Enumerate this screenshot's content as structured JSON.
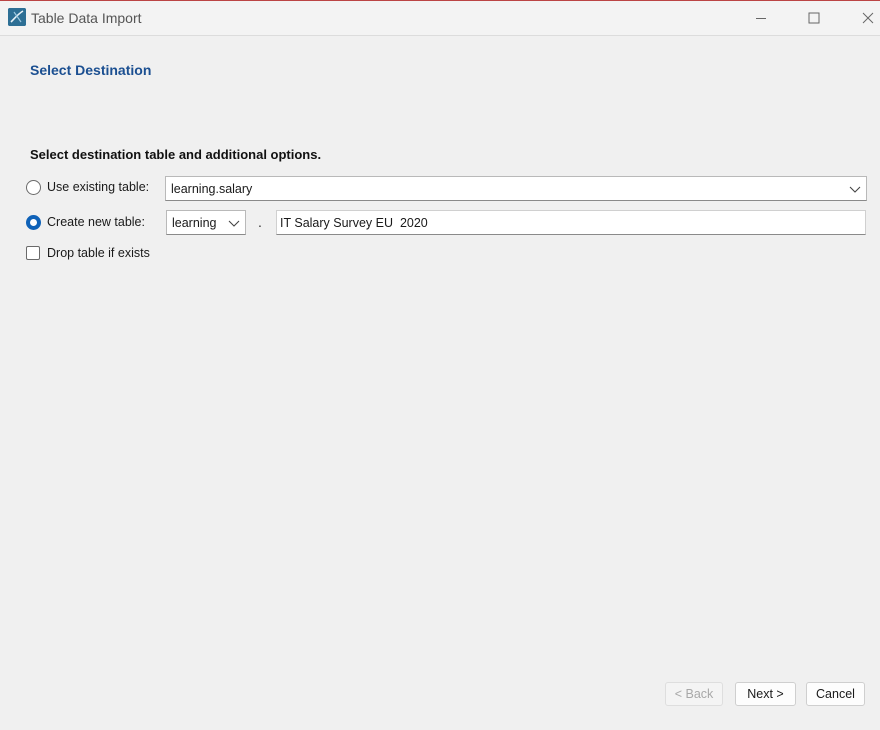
{
  "window": {
    "title": "Table Data Import"
  },
  "page": {
    "title": "Select Destination",
    "section_heading": "Select destination table and additional options."
  },
  "options": {
    "use_existing": {
      "label": "Use existing table:",
      "selected": false,
      "value": "learning.salary"
    },
    "create_new": {
      "label": "Create new table:",
      "selected": true,
      "schema_value": "learning",
      "separator": ".",
      "table_name": "IT Salary Survey EU  2020"
    },
    "drop_if_exists": {
      "label": "Drop table if exists",
      "checked": false
    }
  },
  "footer": {
    "back_label": "< Back",
    "next_label": "Next >",
    "cancel_label": "Cancel"
  },
  "colors": {
    "heading_blue": "#1b4f91",
    "radio_accent": "#0f62b8"
  }
}
